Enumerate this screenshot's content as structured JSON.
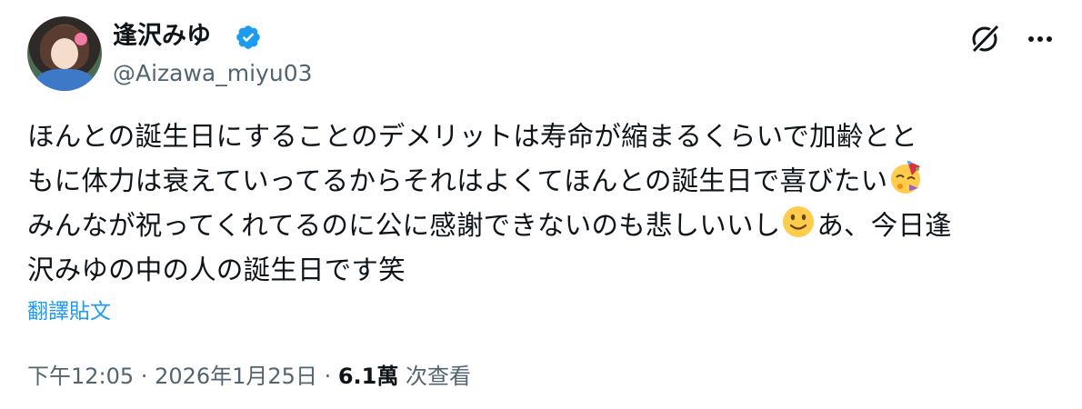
{
  "author": {
    "display_name": "逢沢みゆ",
    "handle": "@Aizawa_miyu03",
    "verified": true
  },
  "tweet": {
    "lines": [
      "ほんとの誕生日にすることのデメリットは寿命が縮まるくらいで加齢とと",
      "もに体力は衰えていってるからそれはよくてほんとの誕生日で喜びたい",
      "みんなが祝ってくれてるのに公に感謝できないのも悲しいいし",
      "あ、今日逢",
      "沢みゆの中の人の誕生日です笑"
    ],
    "emojis": [
      "partying-face-emoji",
      "slightly-smiling-face-emoji"
    ]
  },
  "translate_label": "翻譯貼文",
  "meta": {
    "time": "下午12:05",
    "sep1": " · ",
    "date": "2026年1月25日",
    "sep2": " · ",
    "views_count": "6.1萬",
    "views_label": " 次查看"
  },
  "icons": [
    "verified-badge-icon",
    "grok-icon",
    "more-options-icon"
  ],
  "colors": {
    "text": "#0f1419",
    "secondary": "#536471",
    "link": "#1d9bf0",
    "verified": "#1d9bf0"
  }
}
